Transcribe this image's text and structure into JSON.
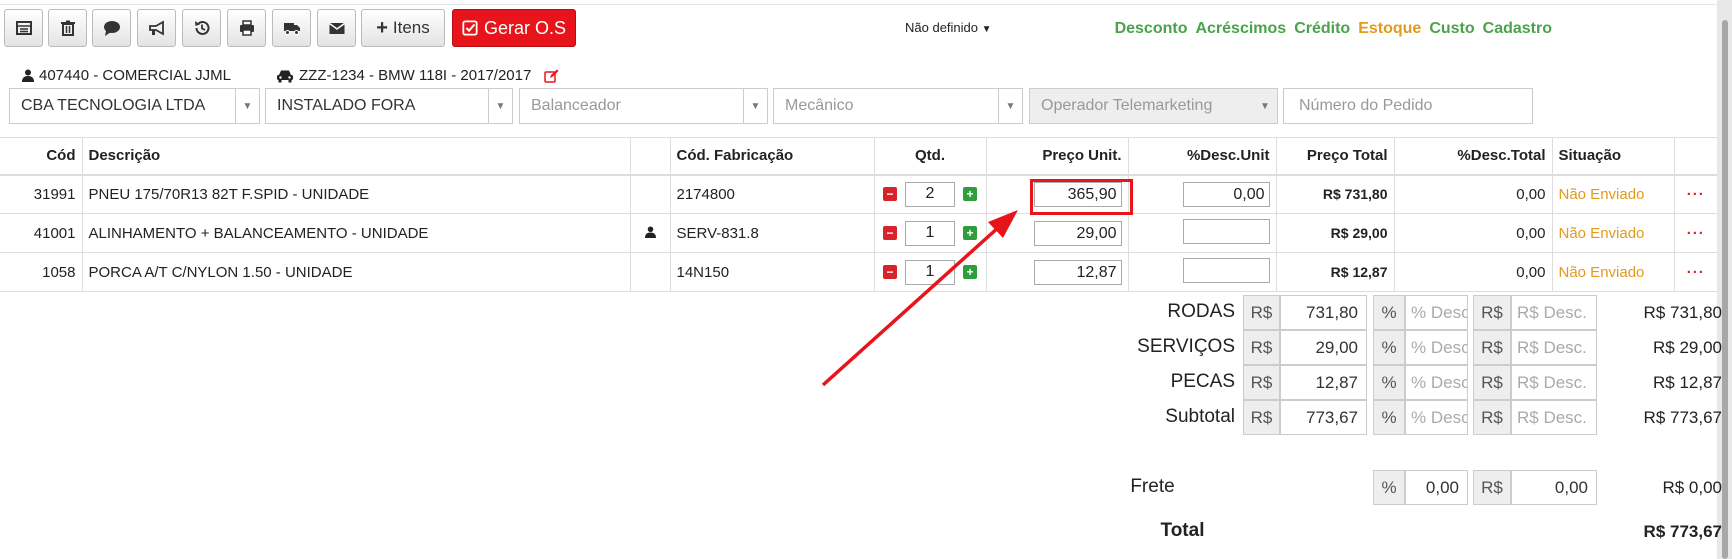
{
  "toolbar": {
    "itens_label": "Itens",
    "gerar_label": "Gerar O.S",
    "status_dropdown": "Não definido"
  },
  "top_links": {
    "desconto": "Desconto",
    "acrescimos": "Acréscimos",
    "credito": "Crédito",
    "estoque": "Estoque",
    "custo": "Custo",
    "cadastro": "Cadastro"
  },
  "customer": {
    "name": "407440 - COMERCIAL JJML",
    "vehicle": "ZZZ-1234 - BMW 118I - 2017/2017"
  },
  "filters": {
    "empresa": "CBA TECNOLOGIA LTDA",
    "local": "INSTALADO FORA",
    "balanceador": "Balanceador",
    "mecanico": "Mecânico",
    "operador": "Operador Telemarketing",
    "pedido_placeholder": "Número do Pedido"
  },
  "table": {
    "headers": {
      "cod": "Cód",
      "descricao": "Descrição",
      "cod_fab": "Cód. Fabricação",
      "qtd": "Qtd.",
      "preco_unit": "Preço Unit.",
      "desc_unit": "%Desc.Unit",
      "preco_total": "Preço Total",
      "desc_total": "%Desc.Total",
      "situacao": "Situação"
    },
    "rows": [
      {
        "cod": "31991",
        "descricao": "PNEU 175/70R13 82T F.SPID - UNIDADE",
        "cod_fab": "2174800",
        "qtd": "2",
        "preco_unit": "365,90",
        "desc_unit": "0,00",
        "preco_total": "R$ 731,80",
        "desc_total": "0,00",
        "situacao": "Não Enviado",
        "more": "···"
      },
      {
        "cod": "41001",
        "descricao": "ALINHAMENTO + BALANCEAMENTO - UNIDADE",
        "cod_fab": "SERV-831.8",
        "qtd": "1",
        "preco_unit": "29,00",
        "desc_unit": "",
        "preco_total": "R$ 29,00",
        "desc_total": "0,00",
        "situacao": "Não Enviado",
        "more": "···"
      },
      {
        "cod": "1058",
        "descricao": "PORCA A/T C/NYLON 1.50 - UNIDADE",
        "cod_fab": "14N150",
        "qtd": "1",
        "preco_unit": "12,87",
        "desc_unit": "",
        "preco_total": "R$ 12,87",
        "desc_total": "0,00",
        "situacao": "Não Enviado",
        "more": "···"
      }
    ]
  },
  "summary": {
    "currency": "R$",
    "percent": "%",
    "pct_placeholder": "% Desc.",
    "rs_placeholder": "R$ Desc.",
    "rows": [
      {
        "label": "RODAS",
        "value": "731,80",
        "total": "R$ 731,80"
      },
      {
        "label": "SERVIÇOS",
        "value": "29,00",
        "total": "R$ 29,00"
      },
      {
        "label": "PECAS",
        "value": "12,87",
        "total": "R$ 12,87"
      },
      {
        "label": "Subtotal",
        "value": "773,67",
        "total": "R$ 773,67"
      }
    ],
    "frete": {
      "label": "Frete",
      "pct": "0,00",
      "rs": "0,00",
      "total": "R$ 0,00"
    },
    "total": {
      "label": "Total",
      "value": "R$ 773,67"
    }
  },
  "colors": {
    "accent_red": "#e8141b",
    "green_link": "#4aa34a",
    "orange": "#e39a1c"
  }
}
